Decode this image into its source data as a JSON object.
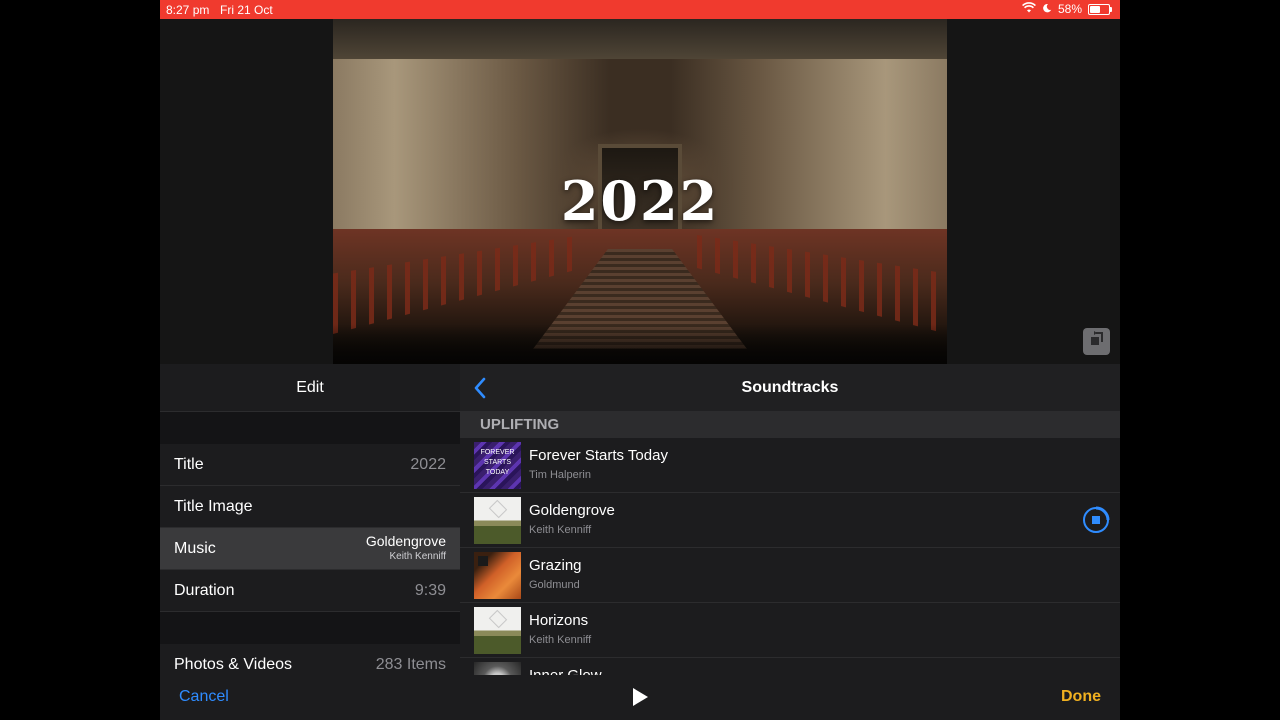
{
  "status_bar": {
    "time": "8:27 pm",
    "date": "Fri 21 Oct",
    "battery": "58%",
    "battery_level": 0.58,
    "bar_color": "#f03a2e"
  },
  "preview": {
    "title_text": "2022",
    "rotate_icon": "rotate-icon"
  },
  "edit_panel": {
    "header": "Edit",
    "rows": [
      {
        "label": "Title",
        "value": "2022"
      },
      {
        "label": "Title Image",
        "value": ""
      },
      {
        "label": "Music",
        "value": "Goldengrove",
        "subvalue": "Keith Kenniff"
      },
      {
        "label": "Duration",
        "value": "9:39"
      },
      {
        "label": "Photos & Videos",
        "value": "283 Items"
      }
    ]
  },
  "soundtracks": {
    "header": "Soundtracks",
    "section": "UPLIFTING",
    "tracks": [
      {
        "name": "Forever Starts Today",
        "artist": "Tim Halperin",
        "art_text": "FOREVER STARTS TODAY"
      },
      {
        "name": "Goldengrove",
        "artist": "Keith Kenniff",
        "playing": true
      },
      {
        "name": "Grazing",
        "artist": "Goldmund"
      },
      {
        "name": "Horizons",
        "artist": "Keith Kenniff"
      },
      {
        "name": "Inner Glow",
        "artist": ""
      }
    ]
  },
  "toolbar": {
    "cancel": "Cancel",
    "done": "Done",
    "accent_blue": "#2f8cff",
    "accent_yellow": "#f0b020"
  }
}
